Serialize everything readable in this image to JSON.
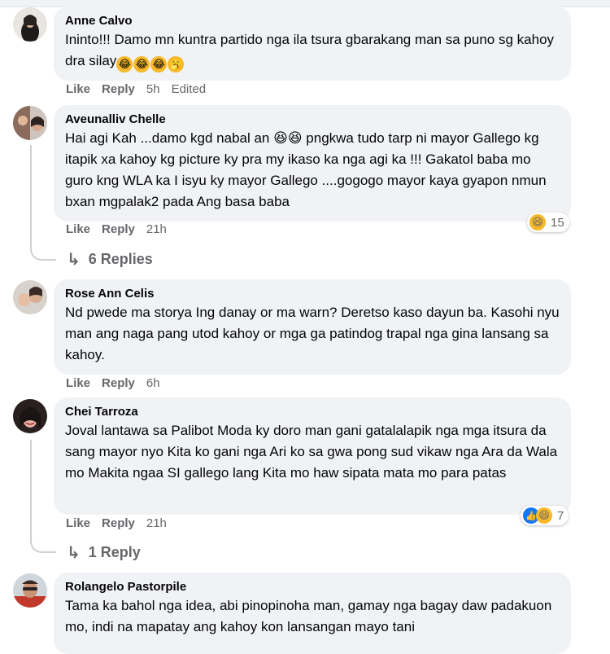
{
  "comments": [
    {
      "author": "Anne Calvo",
      "text": "Ininto!!! Damo mn kuntra partido nga ila tsura gbarakang man sa puno sg kahoy dra silay",
      "emojis": [
        "😂",
        "😂",
        "😂",
        "🥱"
      ],
      "like": "Like",
      "reply": "Reply",
      "time": "5h",
      "edited": "Edited"
    },
    {
      "author": "Aveunalliv Chelle",
      "text": "Hai agi Kah ...damo kgd nabal an 😆😆 pngkwa tudo tarp ni mayor Gallego kg itapik xa kahoy kg picture ky pra my ikaso ka nga agi ka !!! Gakatol baba mo guro kng WLA ka I isyu ky mayor Gallego ....gogogo mayor kaya gyapon nmun bxan mgpalak2 pada Ang basa baba",
      "like": "Like",
      "reply": "Reply",
      "time": "21h",
      "reaction_count": "15",
      "replies_label": "6 Replies"
    },
    {
      "author": "Rose Ann Celis",
      "text": "Nd pwede ma storya Ing danay or ma warn? Deretso kaso dayun ba. Kasohi nyu man ang naga pang utod kahoy or mga ga patindog trapal nga gina lansang sa kahoy.",
      "like": "Like",
      "reply": "Reply",
      "time": "6h"
    },
    {
      "author": "Chei Tarroza",
      "text": "Joval lantawa sa Palibot Moda ky doro man gani gatalalapik nga mga itsura da sang mayor nyo Kita ko gani nga Ari ko sa gwa pong sud vikaw nga Ara da Wala mo Makita ngaa SI gallego lang Kita mo haw sipata mata mo para patas",
      "like": "Like",
      "reply": "Reply",
      "time": "21h",
      "reaction_count": "7",
      "replies_label": "1 Reply"
    },
    {
      "author": "Rolangelo Pastorpile",
      "text": "Tama ka bahol nga idea, abi pinopinoha man, gamay nga bagay daw padakuon mo, indi na mapatay ang kahoy kon lansangan mayo tani"
    }
  ],
  "colors": {
    "bubble": "#f0f2f5",
    "meta": "#65676b",
    "like_blue": "#1877f2",
    "haha_yellow": "#f7b928"
  },
  "icons": [
    "reply-arrow-icon",
    "haha-reaction-icon",
    "like-reaction-icon"
  ]
}
